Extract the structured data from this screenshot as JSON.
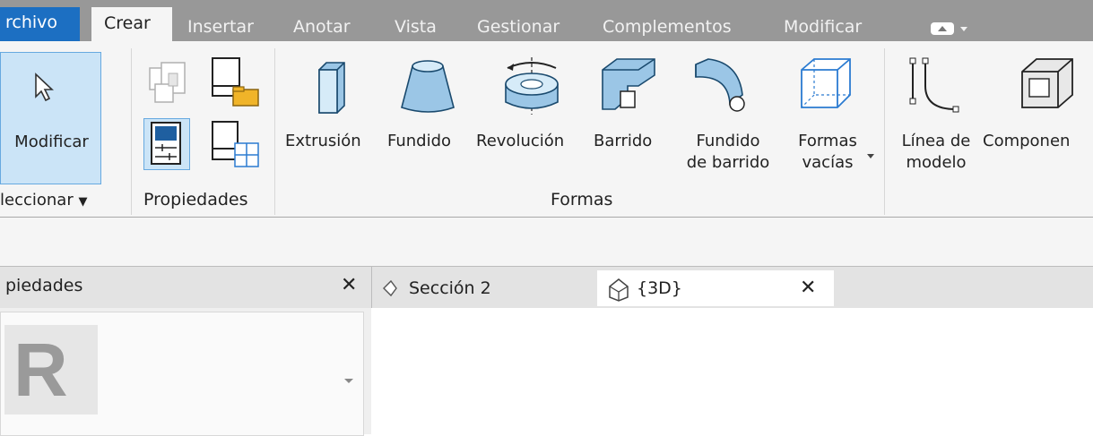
{
  "menu": {
    "tabs": [
      "rchivo",
      "Crear",
      "Insertar",
      "Anotar",
      "Vista",
      "Gestionar",
      "Complementos",
      "Modificar"
    ]
  },
  "ribbon": {
    "modify_label": "Modificar",
    "select_label": "leccionar",
    "properties_group_label": "Propiedades",
    "forms_group_label": "Formas",
    "buttons": {
      "extrusion": "Extrusión",
      "fundido": "Fundido",
      "revolucion": "Revolución",
      "barrido": "Barrido",
      "fundido_barrido_1": "Fundido",
      "fundido_barrido_2": "de barrido",
      "formas_vacias_1": "Formas",
      "formas_vacias_2": "vacías",
      "linea_modelo_1": "Línea de",
      "linea_modelo_2": "modelo",
      "componente": "Componen"
    }
  },
  "properties_panel": {
    "title": "piedades",
    "close": "✕",
    "logo_letter": "R"
  },
  "doc_tabs": {
    "section": "Sección 2",
    "view3d": "{3D}",
    "close": "✕"
  },
  "colors": {
    "file_tab": "#1c6fc2",
    "menubar": "#989898",
    "ribbon": "#f5f5f5",
    "icon_blue": "#9bc6e6"
  }
}
